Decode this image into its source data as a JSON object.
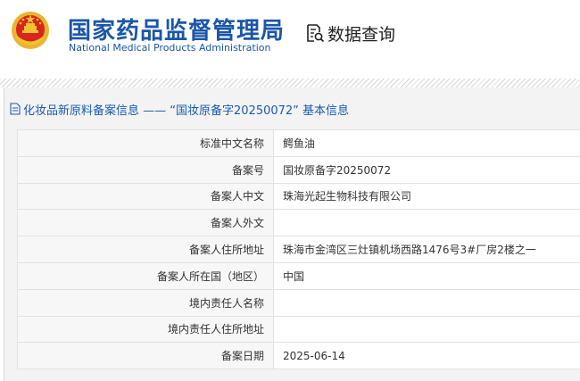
{
  "header": {
    "org_name_cn": "国家药品监督管理局",
    "org_name_en": "National Medical Products Administration",
    "query_label": "数据查询",
    "emblem_icon": "national-emblem-icon",
    "query_icon": "document-search-icon"
  },
  "section": {
    "title": "化妆品新原料备案信息 —— “国妆原备字20250072” 基本信息",
    "title_icon": "document-icon"
  },
  "rows": [
    {
      "label": "标准中文名称",
      "value": "鳄鱼油"
    },
    {
      "label": "备案号",
      "value": "国妆原备字20250072"
    },
    {
      "label": "备案人中文",
      "value": "珠海光起生物科技有限公司"
    },
    {
      "label": "备案人外文",
      "value": ""
    },
    {
      "label": "备案人住所地址",
      "value": "珠海市金湾区三灶镇机场西路1476号3#厂房2楼之一"
    },
    {
      "label": "备案人所在国（地区）",
      "value": "中国"
    },
    {
      "label": "境内责任人名称",
      "value": ""
    },
    {
      "label": "境内责任人住所地址",
      "value": ""
    },
    {
      "label": "备案日期",
      "value": "2025-06-14"
    }
  ],
  "colors": {
    "brand_blue": "#1a56a8",
    "title_blue": "#1a5bb0",
    "emblem_red": "#d7261e",
    "emblem_gold": "#f2c230"
  }
}
